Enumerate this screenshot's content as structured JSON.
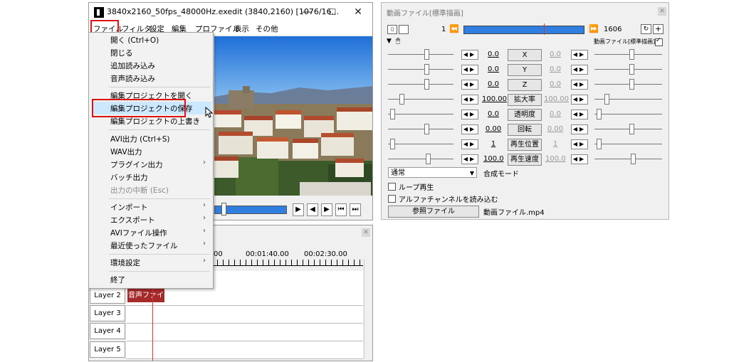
{
  "main_window": {
    "title": "3840x2160_50fps_48000Hz.exedit (3840,2160)  [1076/16...",
    "controls": {
      "minimize": "—",
      "maximize": "☐",
      "close": "✕"
    },
    "menu": [
      "ファイル",
      "フィルタ",
      "設定",
      "編集",
      "プロファイル",
      "表示",
      "その他"
    ]
  },
  "file_menu": {
    "group1": [
      "開く (Ctrl+O)",
      "閉じる",
      "追加読み込み",
      "音声読み込み"
    ],
    "group2": [
      "編集プロジェクトを開く",
      "編集プロジェクトの保存",
      "編集プロジェクトの上書き"
    ],
    "group3": [
      "AVI出力 (Ctrl+S)",
      "WAV出力",
      "プラグイン出力",
      "バッチ出力",
      "出力の中断 (Esc)"
    ],
    "group4": [
      "インポート",
      "エクスポート",
      "AVIファイル操作",
      "最近使ったファイル"
    ],
    "group5": [
      "環境設定"
    ],
    "group6": [
      "終了"
    ],
    "submenu_arrow": "›",
    "highlighted_item": "編集プロジェクトの保存",
    "accent_color": "#dd1111",
    "highlight_color": "#cce8ff"
  },
  "timeline": {
    "times": [
      "00",
      "00:01:40.00",
      "00:02:30.00"
    ],
    "layers": [
      "Layer 2",
      "Layer 3",
      "Layer 4",
      "Layer 5"
    ],
    "clip_label": "音声ファイル",
    "clip_color": "#a52a2a"
  },
  "property_window": {
    "title": "動画ファイル[標準描画]",
    "frame_start": "1",
    "frame_end": "1606",
    "filter_label": "動画ファイル[標準描画]",
    "params": [
      {
        "label": "X",
        "left": "0.0",
        "right": "0.0"
      },
      {
        "label": "Y",
        "left": "0.0",
        "right": "0.0"
      },
      {
        "label": "Z",
        "left": "0.0",
        "right": "0.0"
      },
      {
        "label": "拡大率",
        "left": "100.00",
        "right": "100.00"
      },
      {
        "label": "透明度",
        "left": "0.0",
        "right": "0.0"
      },
      {
        "label": "回転",
        "left": "0.00",
        "right": "0.00"
      },
      {
        "label": "再生位置",
        "left": "1",
        "right": "1"
      },
      {
        "label": "再生速度",
        "left": "100.0",
        "right": "100.0"
      }
    ],
    "blend_select": "通常",
    "blend_label": "合成モード",
    "loop_label": "ループ再生",
    "alpha_label": "アルファチャンネルを読み込む",
    "ref_button": "参照ファイル",
    "file_name": "動画ファイル.mp4",
    "progress_bar_color": "#2f7ee0"
  }
}
